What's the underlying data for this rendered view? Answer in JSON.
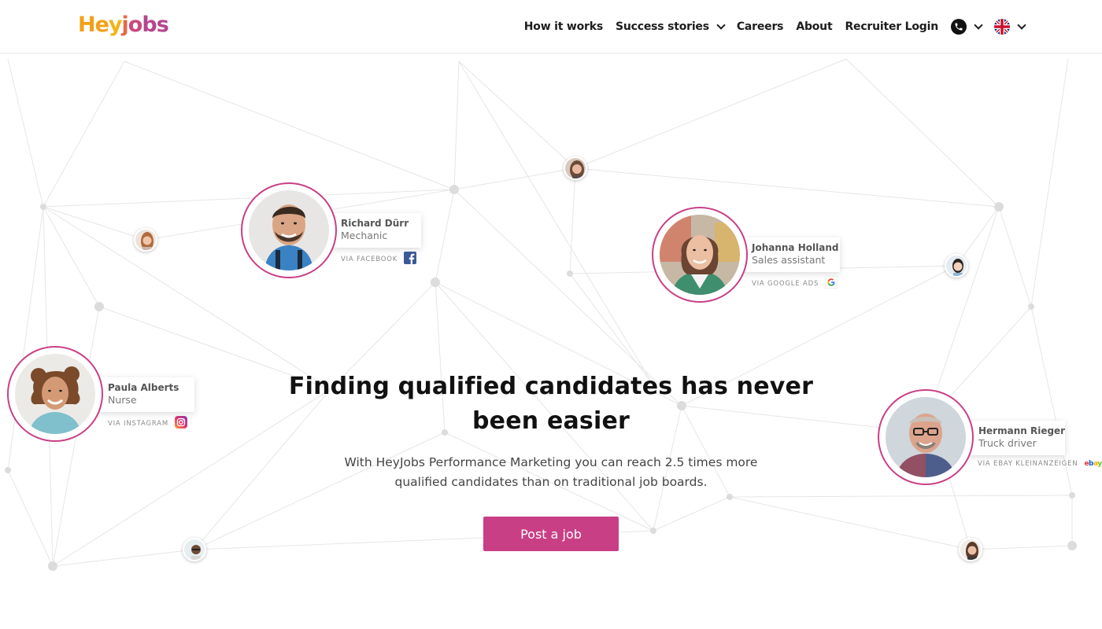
{
  "header": {
    "logo_text": "Heyjobs",
    "nav": {
      "how_it_works": "How it works",
      "success_stories": "Success stories",
      "careers": "Careers",
      "about": "About",
      "recruiter_login": "Recruiter Login"
    },
    "icons": {
      "phone": "phone-icon",
      "language": "uk-flag-icon"
    }
  },
  "hero": {
    "title": "Finding qualified candidates has never been easier",
    "subtitle": "With HeyJobs Performance Marketing you can reach 2.5 times more qualified candidates than on traditional job boards.",
    "cta_label": "Post a job"
  },
  "candidates": [
    {
      "name": "Richard Dürr",
      "role": "Mechanic",
      "via": "VIA FACEBOOK",
      "source_icon": "facebook-icon"
    },
    {
      "name": "Johanna Holland",
      "role": "Sales assistant",
      "via": "VIA GOOGLE ADS",
      "source_icon": "google-icon"
    },
    {
      "name": "Paula Alberts",
      "role": "Nurse",
      "via": "VIA INSTAGRAM",
      "source_icon": "instagram-icon"
    },
    {
      "name": "Hermann Rieger",
      "role": "Truck driver",
      "via": "VIA EBAY KLEINANZEIGEN",
      "source_icon": "ebay-icon"
    }
  ],
  "colors": {
    "brand_pink": "#c93f85",
    "logo_orange": "#f2a01a",
    "logo_yellow": "#f4c316",
    "logo_purple": "#b4468d",
    "network_line": "#e6e6e6",
    "network_node": "#dcdcdc"
  }
}
